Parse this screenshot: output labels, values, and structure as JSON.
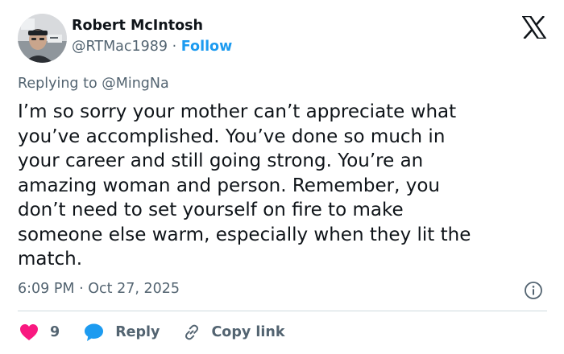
{
  "author": {
    "name": "Robert McIntosh",
    "handle": "@RTMac1989",
    "separator": "·",
    "follow_label": "Follow"
  },
  "reply_context": {
    "prefix": "Replying to",
    "mention": "@MingNa"
  },
  "tweet": {
    "text": "I’m so sorry your mother can’t appreciate what\nyou’ve accomplished.  You’ve done so much in\nyour career and still going strong.  You’re an\namazing woman and person.  Remember, you\ndon’t need to set yourself on fire to make\nsomeone else warm, especially when they lit the\nmatch.",
    "time": "6:09 PM",
    "date_separator": "·",
    "date": "Oct 27, 2025"
  },
  "actions": {
    "like_count": "9",
    "reply_label": "Reply",
    "copy_link_label": "Copy link"
  },
  "icons": {
    "brand": "x-logo-icon",
    "info": "info-icon",
    "like": "heart-icon",
    "reply": "speech-bubble-icon",
    "link": "link-icon"
  },
  "colors": {
    "text": "#0f1419",
    "muted": "#536471",
    "accent": "#1d9bf0",
    "like": "#f91880",
    "divider": "#cfd9de"
  }
}
